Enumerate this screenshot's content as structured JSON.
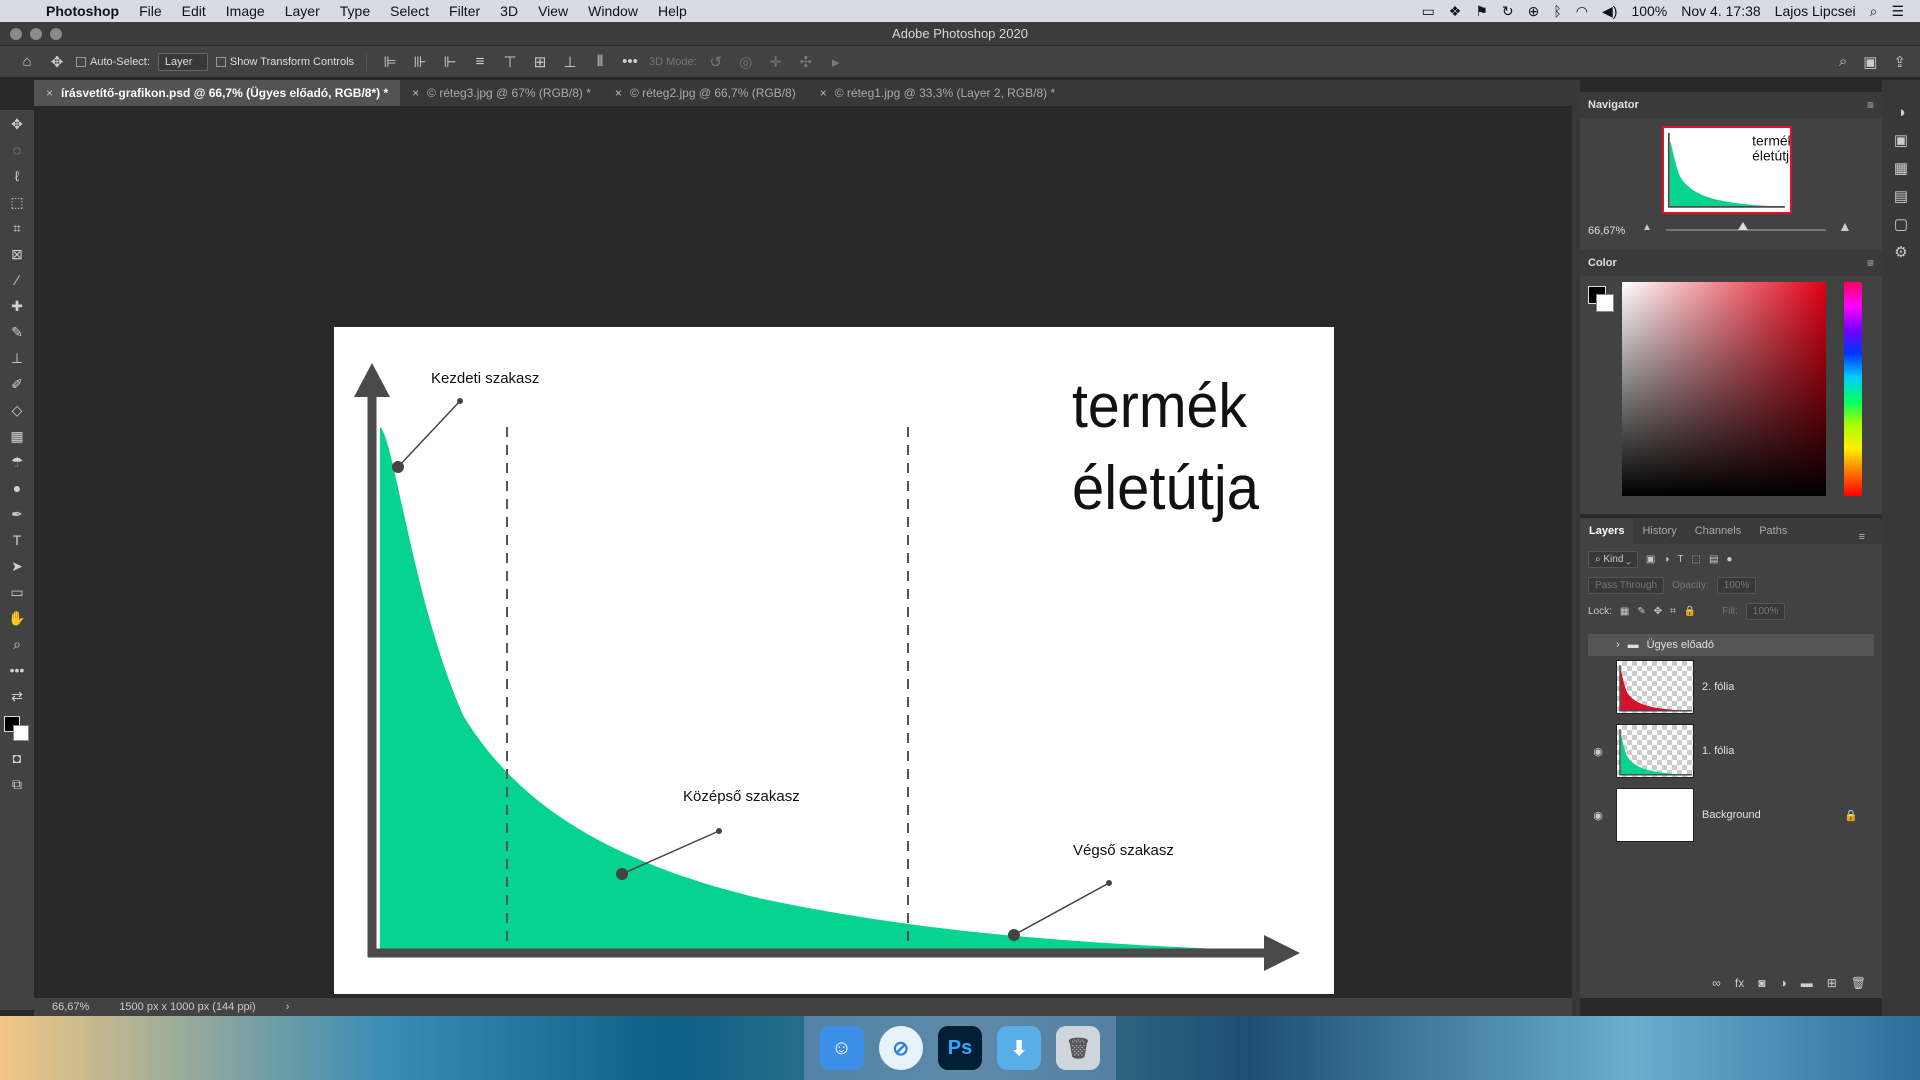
{
  "menubar": {
    "app": "Photoshop",
    "items": [
      "File",
      "Edit",
      "Image",
      "Layer",
      "Type",
      "Select",
      "Filter",
      "3D",
      "View",
      "Window",
      "Help"
    ],
    "battery": "100%",
    "datetime": "Nov 4. 17:38",
    "user": "Lajos Lipcsei"
  },
  "window": {
    "title": "Adobe Photoshop 2020"
  },
  "options": {
    "auto_select_label": "Auto-Select:",
    "auto_select_value": "Layer",
    "transform_label": "Show Transform Controls",
    "mode_label": "3D Mode:"
  },
  "tabs": [
    "írásvetítő-grafikon.psd @ 66,7% (Ügyes előadó, RGB/8*) *",
    "© réteg3.jpg @ 67% (RGB/8) *",
    "© réteg2.jpg @ 66,7% (RGB/8)",
    "© réteg1.jpg @ 33,3% (Layer 2, RGB/8) *"
  ],
  "artwork": {
    "title_line1": "termék",
    "title_line2": "életútja",
    "label_start": "Kezdeti szakasz",
    "label_middle": "Középső szakasz",
    "label_end": "Végső szakasz",
    "curve_color": "#05d38f"
  },
  "status": {
    "zoom": "66,67%",
    "doc_size": "1500 px x 1000 px (144 ppi)"
  },
  "navigator": {
    "title": "Navigator",
    "zoom": "66,67%"
  },
  "color_panel": {
    "title": "Color"
  },
  "layers_panel": {
    "tabs": [
      "Layers",
      "History",
      "Channels",
      "Paths"
    ],
    "filter_kind": "Kind",
    "blend_mode": "Pass Through",
    "opacity_label": "Opacity:",
    "opacity_value": "100%",
    "lock_label": "Lock:",
    "fill_label": "Fill:",
    "fill_value": "100%",
    "group_name": "Ügyes előadó",
    "layers": [
      {
        "name": "2. fólia",
        "visible": false,
        "fill": "#d9102c"
      },
      {
        "name": "1. fólia",
        "visible": true,
        "fill": "#05d38f"
      },
      {
        "name": "Background",
        "visible": true,
        "fill": "#ffffff"
      }
    ]
  },
  "dock": [
    "Finder",
    "Safari",
    "Ps",
    "Downloads",
    "Trash"
  ]
}
